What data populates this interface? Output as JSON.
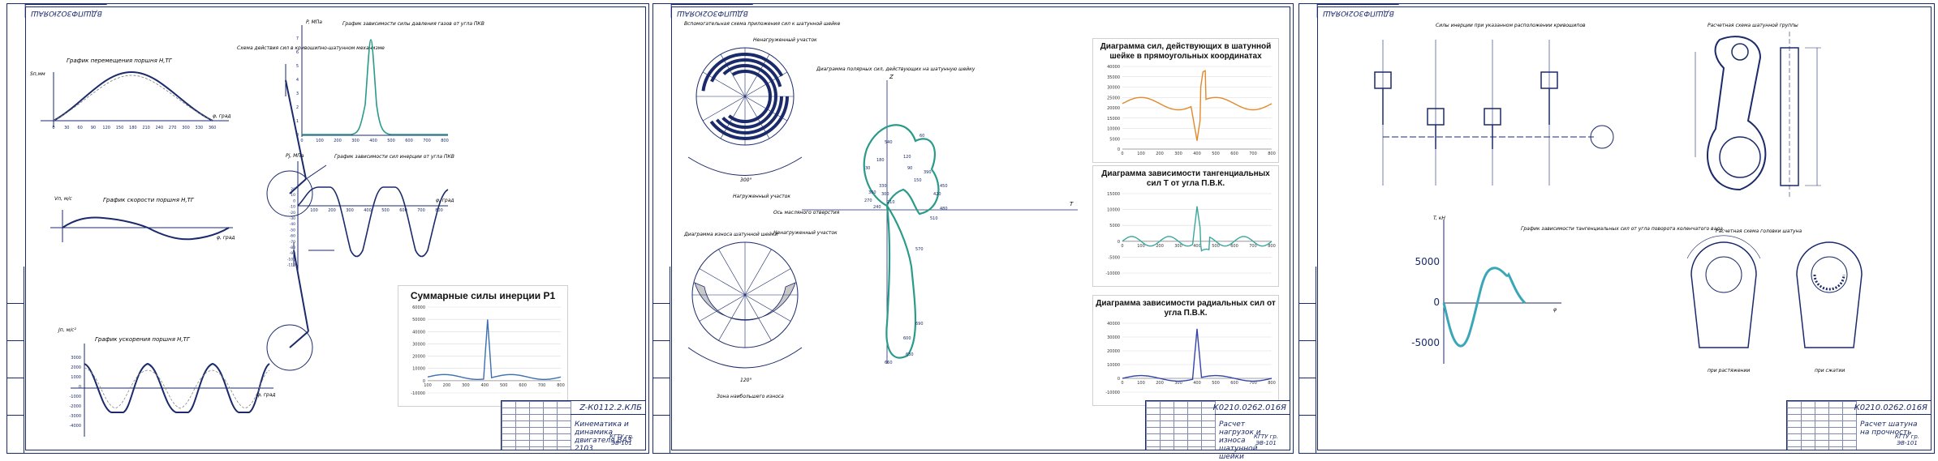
{
  "sheets": [
    {
      "corner": "ВДШПФЗО2ЮЯАШ",
      "stamp": {
        "code": "Z-К0112.2.КЛБ",
        "name": "Кинематика и динамика двигателя ВАЗ 2103",
        "org": "КГТУ гр. ЭВ-101"
      },
      "labels": {
        "disp_title": "График перемещения поршня Н,ТГ",
        "vel_title": "График скорости поршня Н,ТГ",
        "acc_title": "График ускорения поршня Н,ТГ",
        "scheme_title": "Схема действия сил в кривошипно-шатунном механизме",
        "gas_title": "График зависимости силы давления газов от угла ПКВ",
        "inert_title": "График зависимости сил инерции от угла ПКВ",
        "phi_label": "φ, град",
        "s_label": "Sп,мм",
        "v_label": "Vп, м/с",
        "j_label": "Jп, м/с²",
        "p_label": "P, МПа",
        "pj_label": "Pj, МПа"
      },
      "disp_ticks": [
        "0",
        "30",
        "60",
        "90",
        "120",
        "150",
        "180",
        "210",
        "240",
        "270",
        "300",
        "330",
        "360"
      ],
      "acc_ticks": [
        "3000",
        "2000",
        "1000",
        "0",
        "-1000",
        "-2000",
        "-3000",
        "-4000"
      ],
      "inert_ticks": [
        "20",
        "10",
        "0",
        "-10",
        "-20",
        "-30",
        "-40",
        "-50",
        "-60",
        "-70",
        "-80",
        "-90",
        "-100",
        "-110"
      ],
      "gas_ticks": [
        "7",
        "6",
        "5",
        "4",
        "3",
        "2",
        "1",
        "0"
      ],
      "gas_x": [
        "0",
        "100",
        "200",
        "300",
        "400",
        "500",
        "600",
        "700",
        "800"
      ],
      "inert_x": [
        "100",
        "200",
        "300",
        "400",
        "500",
        "600",
        "700",
        "800"
      ]
    },
    {
      "corner": "ВДШПФЗО2ЮЯАШ",
      "stamp": {
        "code": "К0210.0262.016Я",
        "name": "Расчет нагрузок и износа шатунной шейки",
        "org": "КГТУ гр. ЭВ-101"
      },
      "labels": {
        "wear_title": "Вспомогательная схема приложения сил к шатунной шейке",
        "wear_diag_title": "Диаграмма износа шатунной шейки",
        "polar_title": "Диаграмма полярных сил, действующих на шатунную шейку",
        "zone_top": "Ненагруженный участок",
        "zone_bottom": "Нагруженный участок",
        "oil_hole": "Ось масляного отверстия",
        "wear_zone": "Зона наибольшего износа",
        "angle_top": "300°",
        "angle_bottom": "120°",
        "axis_z": "Z",
        "axis_t": "T"
      },
      "polar_points": [
        "540",
        "180",
        "30",
        "360",
        "270",
        "240",
        "60",
        "120",
        "90",
        "150",
        "210",
        "300",
        "330",
        "420",
        "480",
        "450",
        "510",
        "390",
        "690",
        "630",
        "600",
        "660",
        "570"
      ]
    },
    {
      "corner": "ВДШПФЗО2ЮЯАШ",
      "stamp": {
        "code": "К0210.0262.016Я",
        "name": "Расчет шатуна на прочность",
        "org": "КГТУ гр. ЭВ-101"
      },
      "labels": {
        "scheme_title": "Силы инерции при указанном расположении кривошипов",
        "conrod_title": "Расчетная схема шатунной группы",
        "torque_title": "График зависимости тангенциальных сил от угла поворота коленчатого вала",
        "cap_title": "Расчетная схема головки шатуна",
        "stretch": "при растяжении",
        "compress": "при сжатии",
        "t_label": "T, кН",
        "phi_label": "φ"
      },
      "torque_ticks": [
        "5000",
        "0",
        "-5000"
      ]
    }
  ],
  "excel_charts": [
    {
      "title": "Диаграмма сил, действующих в шатунной шейке в прямоугольных координатах",
      "yticks": [
        "40000",
        "35000",
        "30000",
        "25000",
        "20000",
        "15000",
        "10000",
        "5000",
        "0"
      ],
      "xticks": [
        "0",
        "100",
        "200",
        "300",
        "400",
        "500",
        "600",
        "700",
        "800"
      ],
      "color": "#e08a2c"
    },
    {
      "title": "Диаграмма зависимости тангенциальных сил Т от угла П.В.К.",
      "yticks": [
        "15000",
        "10000",
        "5000",
        "0",
        "-5000",
        "-10000"
      ],
      "xticks": [
        "0",
        "100",
        "200",
        "300",
        "400",
        "500",
        "600",
        "700",
        "800"
      ],
      "color": "#3aa6a0"
    },
    {
      "title": "Диаграмма зависимости радиальных сил от угла П.В.К.",
      "yticks": [
        "40000",
        "30000",
        "20000",
        "10000",
        "0",
        "-10000"
      ],
      "xticks": [
        "0",
        "100",
        "200",
        "300",
        "400",
        "500",
        "600",
        "700",
        "800"
      ],
      "color": "#3344aa"
    },
    {
      "title": "Суммарные силы инерции Р1",
      "yticks": [
        "60000",
        "50000",
        "40000",
        "30000",
        "20000",
        "10000",
        "0",
        "-10000"
      ],
      "xticks": [
        "100",
        "200",
        "300",
        "400",
        "500",
        "600",
        "700",
        "800"
      ],
      "color": "#3a6fb0"
    }
  ]
}
